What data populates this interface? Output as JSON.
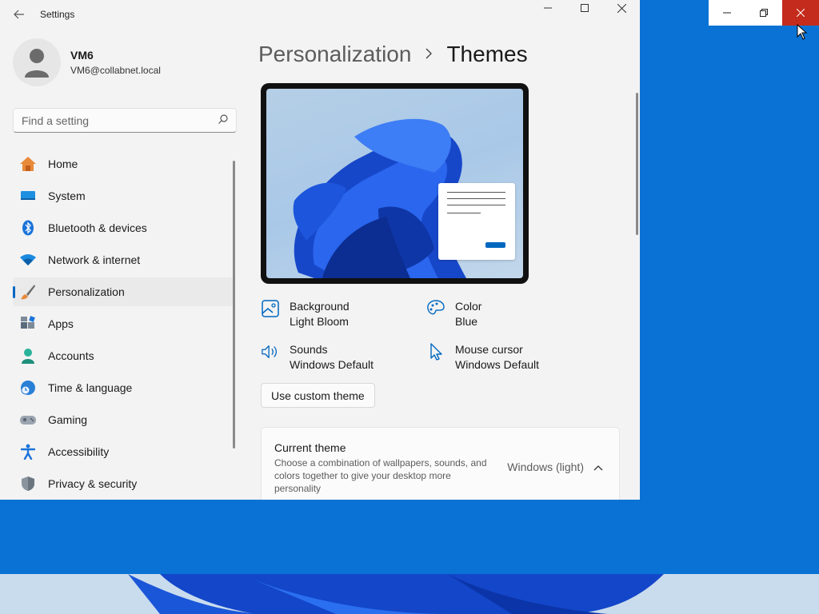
{
  "window": {
    "title": "Settings"
  },
  "profile": {
    "name": "VM6",
    "email": "VM6@collabnet.local"
  },
  "search": {
    "placeholder": "Find a setting"
  },
  "sidebar": {
    "items": [
      {
        "label": "Home",
        "icon": "home-icon"
      },
      {
        "label": "System",
        "icon": "system-icon"
      },
      {
        "label": "Bluetooth & devices",
        "icon": "bluetooth-icon"
      },
      {
        "label": "Network & internet",
        "icon": "wifi-icon"
      },
      {
        "label": "Personalization",
        "icon": "brush-icon",
        "active": true
      },
      {
        "label": "Apps",
        "icon": "apps-icon"
      },
      {
        "label": "Accounts",
        "icon": "person-icon"
      },
      {
        "label": "Time & language",
        "icon": "globe-clock-icon"
      },
      {
        "label": "Gaming",
        "icon": "gamepad-icon"
      },
      {
        "label": "Accessibility",
        "icon": "accessibility-icon"
      },
      {
        "label": "Privacy & security",
        "icon": "shield-icon"
      }
    ]
  },
  "breadcrumb": {
    "parent": "Personalization",
    "current": "Themes"
  },
  "theme_props": {
    "background": {
      "title": "Background",
      "value": "Light Bloom"
    },
    "color": {
      "title": "Color",
      "value": "Blue"
    },
    "sounds": {
      "title": "Sounds",
      "value": "Windows Default"
    },
    "mouse_cursor": {
      "title": "Mouse cursor",
      "value": "Windows Default"
    }
  },
  "custom_theme_button": "Use custom theme",
  "current_theme": {
    "title": "Current theme",
    "description": "Choose a combination of wallpapers, sounds, and colors together to give your desktop more personality",
    "value": "Windows (light)"
  },
  "colors": {
    "accent": "#0067c0",
    "desktop": "#0a72d4",
    "close_hover": "#c42b1c"
  }
}
